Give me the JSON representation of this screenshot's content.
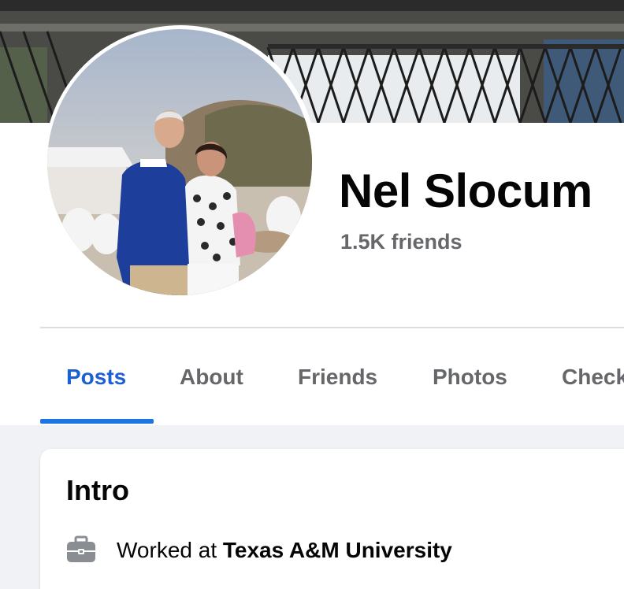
{
  "profile": {
    "name": "Nel Slocum",
    "friends_count": "1.5K friends"
  },
  "tabs": [
    {
      "label": "Posts",
      "active": true
    },
    {
      "label": "About",
      "active": false
    },
    {
      "label": "Friends",
      "active": false
    },
    {
      "label": "Photos",
      "active": false
    },
    {
      "label": "Check-ins",
      "active": false
    }
  ],
  "intro": {
    "title": "Intro",
    "work_prefix": "Worked at ",
    "work_place": "Texas A&M University",
    "work_icon": "briefcase-icon"
  },
  "colors": {
    "accent": "#1b74e4",
    "active_tab_text": "#1b5fd1",
    "muted_text": "#65676b",
    "page_background": "#f0f2f5"
  }
}
